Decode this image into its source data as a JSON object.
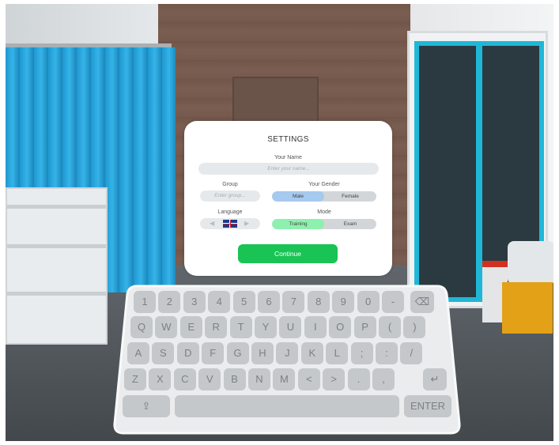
{
  "settings": {
    "title": "SETTINGS",
    "name_label": "Your Name",
    "name_placeholder": "Enter your name...",
    "group_label": "Group",
    "group_placeholder": "Enter group...",
    "gender_label": "Your Gender",
    "gender_options": [
      "Male",
      "Female"
    ],
    "gender_selected": "Male",
    "language_label": "Language",
    "language_flag": "uk-flag-icon",
    "mode_label": "Mode",
    "mode_options": [
      "Training",
      "Exam"
    ],
    "mode_selected": "Training",
    "continue_label": "Continue"
  },
  "keyboard": {
    "row1": [
      "1",
      "2",
      "3",
      "4",
      "5",
      "6",
      "7",
      "8",
      "9",
      "0",
      "-"
    ],
    "row2": [
      "Q",
      "W",
      "E",
      "R",
      "T",
      "Y",
      "U",
      "I",
      "O",
      "P",
      "(",
      ")"
    ],
    "row3": [
      "A",
      "S",
      "D",
      "F",
      "G",
      "H",
      "J",
      "K",
      "L",
      ";",
      ":",
      "/"
    ],
    "row4": [
      "Z",
      "X",
      "C",
      "V",
      "B",
      "N",
      "M",
      "<",
      ">",
      ".",
      ","
    ],
    "backspace_icon": "backspace-icon",
    "enter_icon": "enter-arrow-icon",
    "share_icon": "share-icon",
    "space_label": "",
    "enter_label": "ENTER"
  },
  "colors": {
    "accent_green": "#19c455",
    "selected_gender": "#a6c9ee",
    "selected_mode": "#8ef0ae"
  }
}
